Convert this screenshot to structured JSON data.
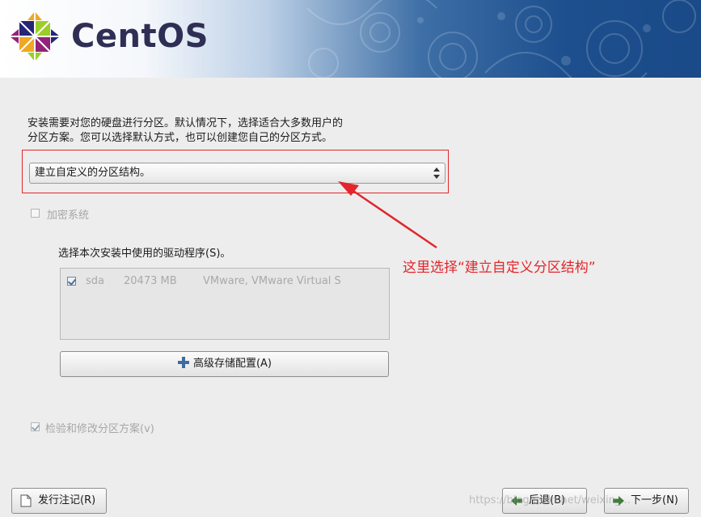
{
  "header": {
    "brand": "CentOS",
    "banner_colors": {
      "start": "#ffffff",
      "end": "#1a4a88"
    }
  },
  "description": {
    "line1": "安装需要对您的硬盘进行分区。默认情况下，选择适合大多数用户的",
    "line2": "分区方案。您可以选择默认方式，也可以创建您自己的分区方式。"
  },
  "partition_select": {
    "selected": "建立自定义的分区结构。"
  },
  "encrypt": {
    "label": "加密系统",
    "checked": false
  },
  "drivers": {
    "label": "选择本次安装中使用的驱动程序(S)。",
    "rows": [
      {
        "checked": true,
        "device": "sda",
        "size": "20473 MB",
        "model": "VMware, VMware Virtual S"
      }
    ]
  },
  "advanced_button": {
    "label": "高级存储配置(A)",
    "icon": "plus-icon"
  },
  "review": {
    "label": "检验和修改分区方案(v)",
    "checked": true
  },
  "annotation": {
    "text": "这里选择“建立自定义分区结构”",
    "color": "#e2262b"
  },
  "buttons": {
    "release_notes": "发行注记(R)",
    "back": "后退(B)",
    "next": "下一步(N)"
  },
  "watermark": "https://blog.csdn.net/weixin_..."
}
